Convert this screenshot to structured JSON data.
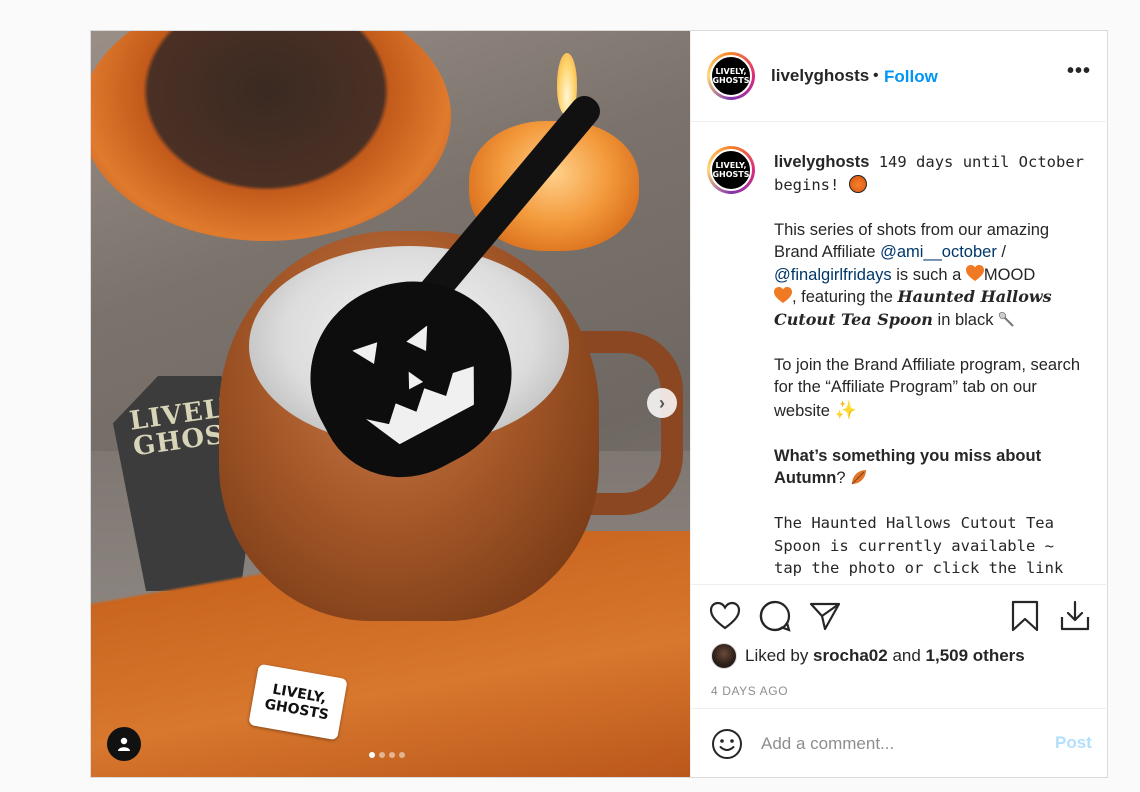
{
  "header": {
    "avatar_text": "LIVELY, GHOSTS",
    "username": "livelyghosts",
    "bullet": "•",
    "follow_label": "Follow",
    "more_label": "•••"
  },
  "media": {
    "coffin_text": "LIVELY GHOSTS",
    "tag_text": "LIVELY, GHOSTS",
    "next_label": "›",
    "carousel_dots": 4,
    "active_dot": 1
  },
  "caption": {
    "username": "livelyghosts",
    "intro": " 149 days until October begins! ",
    "p1_a": "This series of shots from our amazing Brand Affiliate ",
    "mention1": "@ami__october",
    "p1_b": " / ",
    "mention2": "@finalgirlfridays",
    "p1_c": " is such a ",
    "p1_d": "MOOD",
    "p1_e": ", featuring the ",
    "product": "Haunted Hallows Cutout Tea Spoon",
    "p1_f": " in black ",
    "p2": "To join the Brand Affiliate program, search for the “Affiliate Program” tab on our website ",
    "q_a": "What’s something you miss about Autumn",
    "q_b": "? ",
    "p4": "The Haunted Hallows Cutout Tea Spoon is currently available ~ tap the photo or click the link"
  },
  "actions": {
    "liked_by_prefix": "Liked by ",
    "liked_user": "srocha02",
    "and": " and ",
    "others": "1,509 others",
    "timestamp": "4 DAYS AGO"
  },
  "comment": {
    "placeholder": "Add a comment...",
    "post_label": "Post"
  },
  "colors": {
    "accent": "#0095f6",
    "link": "#00376b",
    "post_disabled": "#b2dffc",
    "heart_orange": "#f07a24"
  },
  "icons": [
    "heart-icon",
    "comment-icon",
    "share-icon",
    "bookmark-icon",
    "download-icon",
    "smile-icon",
    "user-tag-icon",
    "more-icon",
    "chevron-right-icon"
  ]
}
